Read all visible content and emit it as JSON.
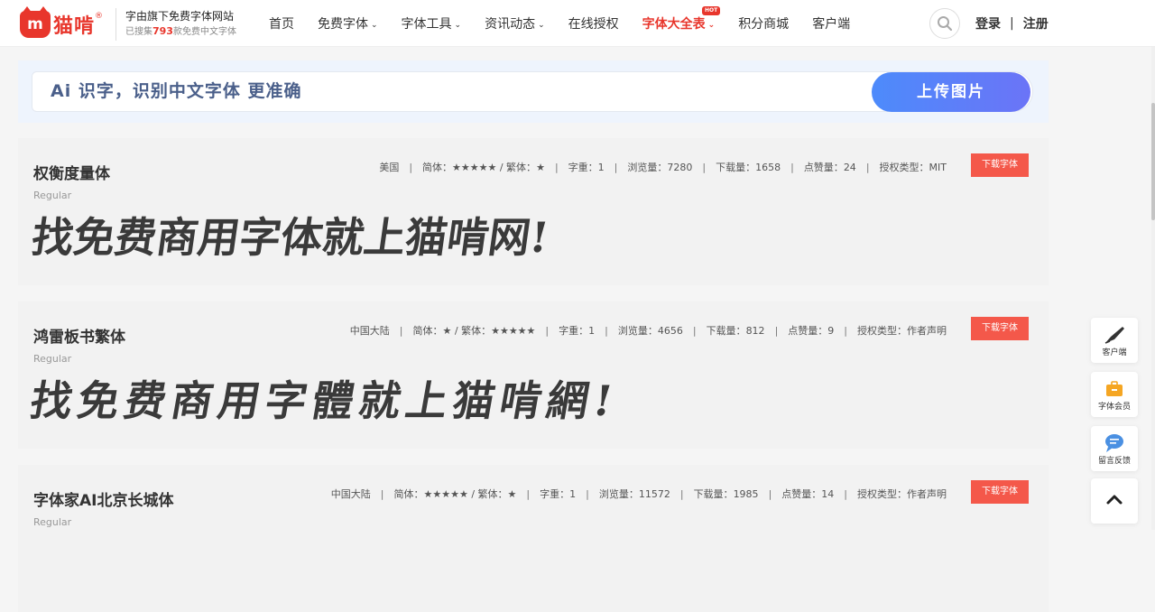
{
  "header": {
    "logo_badge": "m",
    "logo_text": "猫啃",
    "logo_reg": "®",
    "tagline_main": "字由旗下免费字体网站",
    "tagline_pre": "已搜集",
    "tagline_count": "793",
    "tagline_post": "款免费中文字体",
    "nav": [
      {
        "label": "首页",
        "dropdown": false
      },
      {
        "label": "免费字体",
        "dropdown": true
      },
      {
        "label": "字体工具",
        "dropdown": true
      },
      {
        "label": "资讯动态",
        "dropdown": true
      },
      {
        "label": "在线授权",
        "dropdown": false
      },
      {
        "label": "字体大全表",
        "dropdown": true,
        "hot": "HOT"
      },
      {
        "label": "积分商城",
        "dropdown": false
      },
      {
        "label": "客户端",
        "dropdown": false
      }
    ],
    "login": "登录",
    "divider": "|",
    "register": "注册"
  },
  "ai_banner": {
    "text": "Ai 识字，识别中文字体 更准确",
    "upload": "上传图片"
  },
  "cards": [
    {
      "name": "权衡度量体",
      "style": "Regular",
      "region": "美国",
      "simp_label": "简体：",
      "simp": "★★★★★",
      "trad_label": " / 繁体：",
      "trad": "★",
      "weight_label": "字重：",
      "weight": "1",
      "views_label": "浏览量：",
      "views": "7280",
      "downloads_label": "下载量：",
      "downloads": "1658",
      "likes_label": "点赞量：",
      "likes": "24",
      "license_label": "授权类型：",
      "license": "MIT",
      "download_btn": "下载字体",
      "preview": "找免费商用字体就上猫啃网!"
    },
    {
      "name": "鸿雷板书繁体",
      "style": "Regular",
      "region": "中国大陆",
      "simp_label": "简体：",
      "simp": "★",
      "trad_label": " / 繁体：",
      "trad": "★★★★★",
      "weight_label": "字重：",
      "weight": "1",
      "views_label": "浏览量：",
      "views": "4656",
      "downloads_label": "下载量：",
      "downloads": "812",
      "likes_label": "点赞量：",
      "likes": "9",
      "license_label": "授权类型：",
      "license": "作者声明",
      "download_btn": "下载字体",
      "preview": "找免费商用字體就上猫啃網!"
    },
    {
      "name": "字体家AI北京长城体",
      "style": "Regular",
      "region": "中国大陆",
      "simp_label": "简体：",
      "simp": "★★★★★",
      "trad_label": " / 繁体：",
      "trad": "★",
      "weight_label": "字重：",
      "weight": "1",
      "views_label": "浏览量：",
      "views": "11572",
      "downloads_label": "下载量：",
      "downloads": "1985",
      "likes_label": "点赞量：",
      "likes": "14",
      "license_label": "授权类型：",
      "license": "作者声明",
      "download_btn": "下载字体",
      "preview": ""
    }
  ],
  "side_toolbar": {
    "client": "客户端",
    "member": "字体会员",
    "feedback": "留言反馈"
  },
  "colors": {
    "brand": "#e8362c",
    "download": "#f4584a",
    "upload_start": "#4d8bfb",
    "upload_end": "#6b74f7"
  }
}
